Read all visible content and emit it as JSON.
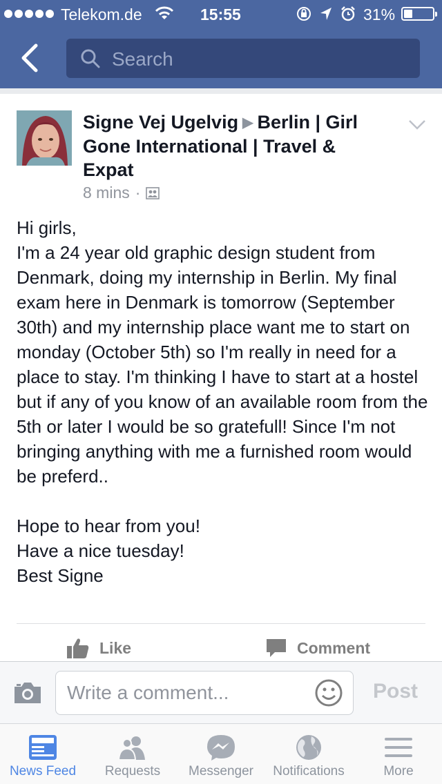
{
  "status_bar": {
    "carrier": "Telekom.de",
    "time": "15:55",
    "battery_percent": "31%",
    "battery_level": 0.31,
    "signal_icon": "signal-dots-icon",
    "wifi_icon": "wifi-icon"
  },
  "nav": {
    "back_icon": "chevron-left-icon",
    "search_placeholder": "Search"
  },
  "post": {
    "author": "Signe Vej Ugelvig",
    "arrow": "▶",
    "group": "Berlin | Girl Gone International | Travel & Expat",
    "time": "8 mins",
    "separator": "·",
    "privacy_icon": "group-icon",
    "body": [
      "Hi girls,",
      "I'm a 24 year old graphic design student from Denmark, doing my internship in Berlin. My final exam here in Denmark is tomorrow (September 30th) and my internship place want me to start on monday (October 5th) so I'm really in need for a place to stay. I'm thinking I have to start at a hostel but if any of you know of an available room from the 5th or later I would be so gratefull! Since I'm not bringing anything with me a furnished room would be preferd..",
      "",
      "Hope to hear from you!",
      "Have a nice tuesday!",
      "Best Signe"
    ],
    "actions": {
      "like": "Like",
      "comment": "Comment"
    }
  },
  "comment_bar": {
    "placeholder": "Write a comment...",
    "post_label": "Post"
  },
  "tab_bar": [
    {
      "label": "News Feed",
      "icon": "news-feed-icon",
      "active": true
    },
    {
      "label": "Requests",
      "icon": "friend-requests-icon",
      "active": false
    },
    {
      "label": "Messenger",
      "icon": "messenger-icon",
      "active": false
    },
    {
      "label": "Notifications",
      "icon": "globe-icon",
      "active": false
    },
    {
      "label": "More",
      "icon": "menu-icon",
      "active": false
    }
  ],
  "colors": {
    "brand": "#4b67a1",
    "active_tab": "#4e86e4",
    "muted": "#8d949e"
  }
}
